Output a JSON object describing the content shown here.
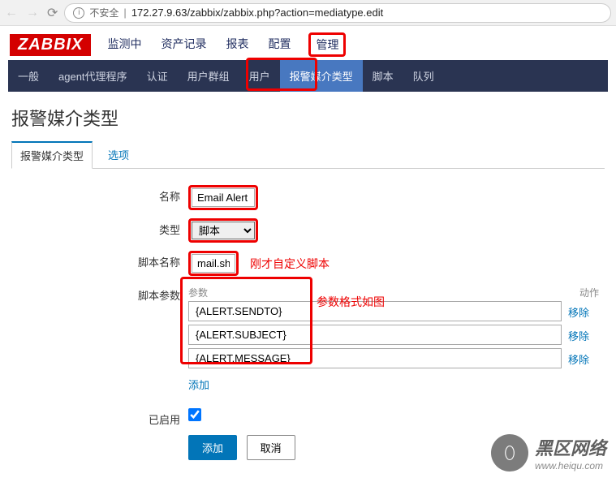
{
  "browser": {
    "insecure_label": "不安全",
    "url": "172.27.9.63/zabbix/zabbix.php?action=mediatype.edit"
  },
  "logo_text": "ZABBIX",
  "topnav": {
    "monitoring": "监测中",
    "inventory": "资产记录",
    "reports": "报表",
    "config": "配置",
    "admin": "管理"
  },
  "subnav": {
    "general": "一般",
    "agent_proxy": "agent代理程序",
    "auth": "认证",
    "user_groups": "用户群组",
    "users": "用户",
    "media_types": "报警媒介类型",
    "scripts": "脚本",
    "queue": "队列"
  },
  "page_title": "报警媒介类型",
  "tabs": {
    "media_type": "报警媒介类型",
    "options": "选项"
  },
  "form": {
    "name_label": "名称",
    "name_value": "Email Alert",
    "type_label": "类型",
    "type_value": "脚本",
    "script_name_label": "脚本名称",
    "script_name_value": "mail.sh",
    "script_name_annotation": "刚才自定义脚本",
    "params_label": "脚本参数",
    "params_header_param": "参数",
    "params_header_action": "动作",
    "params_annotation": "参数格式如图",
    "params": [
      {
        "value": "{ALERT.SENDTO}",
        "remove": "移除"
      },
      {
        "value": "{ALERT.SUBJECT}",
        "remove": "移除"
      },
      {
        "value": "{ALERT.MESSAGE}",
        "remove": "移除"
      }
    ],
    "add_param": "添加",
    "enabled_label": "已启用",
    "enabled_value": true,
    "submit": "添加",
    "cancel": "取消"
  },
  "watermark": {
    "cn": "黑区网络",
    "url": "www.heiqu.com"
  }
}
